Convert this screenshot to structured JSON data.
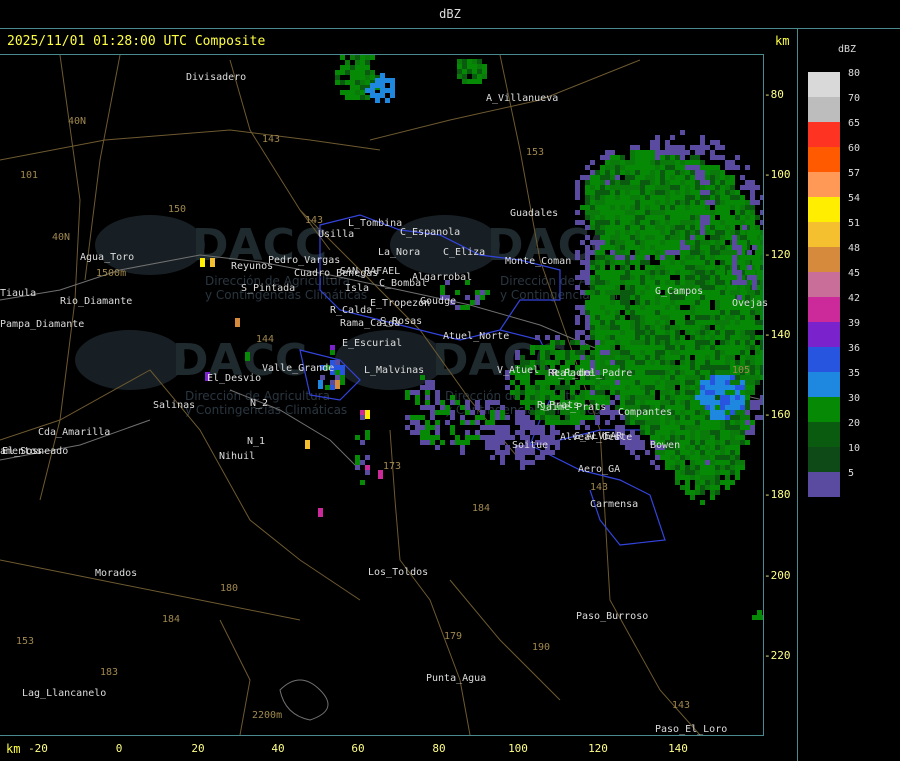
{
  "title": "dBZ",
  "timestamp": "2025/11/01 01:28:00 UTC Composite",
  "unit_top": "km",
  "unit_bottom": "km",
  "y_ticks": [
    "-80",
    "-100",
    "-120",
    "-140",
    "-160",
    "-180",
    "-200",
    "-220"
  ],
  "x_ticks": [
    "-20",
    "0",
    "20",
    "40",
    "60",
    "80",
    "100",
    "120",
    "140"
  ],
  "legend": {
    "title": "dBZ",
    "levels": [
      {
        "value": "80",
        "color": "#d9d9d9"
      },
      {
        "value": "70",
        "color": "#bdbdbd"
      },
      {
        "value": "65",
        "color": "#ff3322"
      },
      {
        "value": "60",
        "color": "#ff5a00"
      },
      {
        "value": "57",
        "color": "#ff9955"
      },
      {
        "value": "54",
        "color": "#ffee00"
      },
      {
        "value": "51",
        "color": "#f5c030"
      },
      {
        "value": "48",
        "color": "#d68a3c"
      },
      {
        "value": "45",
        "color": "#c86e98"
      },
      {
        "value": "42",
        "color": "#cc2a9a"
      },
      {
        "value": "39",
        "color": "#7a22cc"
      },
      {
        "value": "36",
        "color": "#2855e0"
      },
      {
        "value": "35",
        "color": "#1e88e0"
      },
      {
        "value": "30",
        "color": "#068a06"
      },
      {
        "value": "20",
        "color": "#0a5a10"
      },
      {
        "value": "10",
        "color": "#0d4a18"
      },
      {
        "value": "5",
        "color": "#5a4aa0"
      }
    ]
  },
  "watermark": {
    "logo": "DACC",
    "line1": "Dirección de Agricultura",
    "line2": "y Contingencias Climáticas"
  },
  "places": [
    "Divisadero",
    "A_Villanueva",
    "Guadales",
    "L_Tombina",
    "Usilla",
    "C_Espanola",
    "La_Nora",
    "C_Eliza",
    "Reyunos",
    "Isla",
    "SAN_RAFAEL",
    "Algarrobal",
    "C_Bombal",
    "Goudge",
    "S_Pintada",
    "R_Calda",
    "E_Tropezon",
    "S_Rosas",
    "Atuel_Norte",
    "E_Escurial",
    "Valle_Grande",
    "L_Malvinas",
    "V_Atuel",
    "El_Desvio",
    "Salinas",
    "R_Prats",
    "G_ALVEAR",
    "Compantes",
    "Bowen",
    "Soitue",
    "Aero_GA",
    "Carmensa",
    "Cda_Amarilla",
    "Nihuil",
    "N_1",
    "N_2",
    "Morados",
    "Los_Toldos",
    "Paso_Burroso",
    "Punta_Agua",
    "Lag_Llancanelo",
    "Paso_El_Loro",
    "Agua_Toro",
    "Pampa_Diamante",
    "Tiaula",
    "Cuadro_Benegas",
    "Rama_Caida",
    "El_Sosneado",
    "Jaime_Prats",
    "G_Campos",
    "Ovejas",
    "Alvear_Oeste",
    "Real_del_Padre",
    "Rio_Diamante",
    "amentos",
    "Monte_Coman",
    "Pedro_Vargas",
    "R_Padre"
  ],
  "road_numbers": [
    "101",
    "40N",
    "40N",
    "143",
    "143",
    "153",
    "150",
    "144",
    "173",
    "184",
    "180",
    "184",
    "183",
    "179",
    "190",
    "143",
    "143",
    "153",
    "105",
    "2200m",
    "1500m"
  ]
}
